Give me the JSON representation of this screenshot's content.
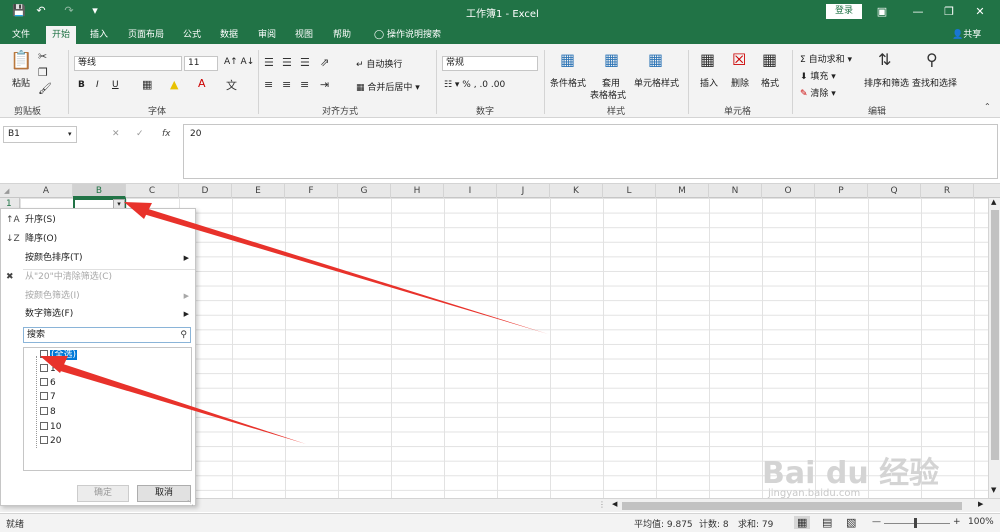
{
  "titlebar": {
    "title": "工作簿1  -  Excel",
    "login_label": "登录",
    "icons": [
      "save-icon",
      "undo-icon",
      "redo-icon",
      "customize-icon",
      "ribbon-display-icon",
      "minimize-icon",
      "restore-icon",
      "close-icon"
    ]
  },
  "tabs": [
    {
      "label": "文件"
    },
    {
      "label": "开始"
    },
    {
      "label": "插入"
    },
    {
      "label": "页面布局"
    },
    {
      "label": "公式"
    },
    {
      "label": "数据"
    },
    {
      "label": "审阅"
    },
    {
      "label": "视图"
    },
    {
      "label": "帮助"
    },
    {
      "label": "操作说明搜索"
    }
  ],
  "share_label": "共享",
  "ribbon": {
    "clipboard": {
      "paste": "粘贴",
      "group": "剪贴板"
    },
    "font": {
      "name": "等线",
      "size": "11",
      "group": "字体",
      "bold": "B",
      "italic": "I",
      "underline": "U"
    },
    "alignment": {
      "wrap": "自动换行",
      "merge": "合并后居中",
      "group": "对齐方式"
    },
    "number": {
      "format": "常规",
      "group": "数字"
    },
    "styles": {
      "cond": "条件格式",
      "table_line1": "套用",
      "table_line2": "表格格式",
      "cell": "单元格样式",
      "group": "样式"
    },
    "cells": {
      "insert": "插入",
      "delete": "删除",
      "format": "格式",
      "group": "单元格"
    },
    "editing": {
      "autosum": "自动求和",
      "fill": "填充",
      "clear": "清除",
      "sortfilter": "排序和筛选",
      "findselect": "查找和选择",
      "group": "编辑"
    }
  },
  "formula": {
    "namebox": "B1",
    "value": "20",
    "fx": "fx"
  },
  "columns": [
    "A",
    "B",
    "C",
    "D",
    "E",
    "F",
    "G",
    "H",
    "I",
    "J",
    "K",
    "L",
    "M",
    "N",
    "O",
    "P",
    "Q",
    "R"
  ],
  "row1": "1",
  "menu": {
    "items": [
      {
        "label": "升序(S)",
        "disabled": false
      },
      {
        "label": "降序(O)",
        "disabled": false
      },
      {
        "label": "按颜色排序(T)",
        "disabled": false,
        "sub": true
      },
      {
        "label": "从\"20\"中清除筛选(C)",
        "disabled": true
      },
      {
        "label": "按颜色筛选(I)",
        "disabled": true,
        "sub": true
      },
      {
        "label": "数字筛选(F)",
        "disabled": false,
        "sub": true
      }
    ],
    "search_placeholder": "搜索",
    "checklist": [
      "(全选)",
      "1",
      "6",
      "7",
      "8",
      "10",
      "20"
    ],
    "ok": "确定",
    "cancel": "取消"
  },
  "statusbar": {
    "ready": "就绪",
    "average": "平均值: 9.875",
    "count": "计数: 8",
    "sum": "求和: 79",
    "zoom": "100%"
  },
  "watermark": {
    "brand": "Bai du 经验",
    "url": "jingyan.baidu.com"
  },
  "colors": {
    "excel_green": "#217346",
    "arrow_red": "#e8322b",
    "highlight": "#0078d7"
  }
}
